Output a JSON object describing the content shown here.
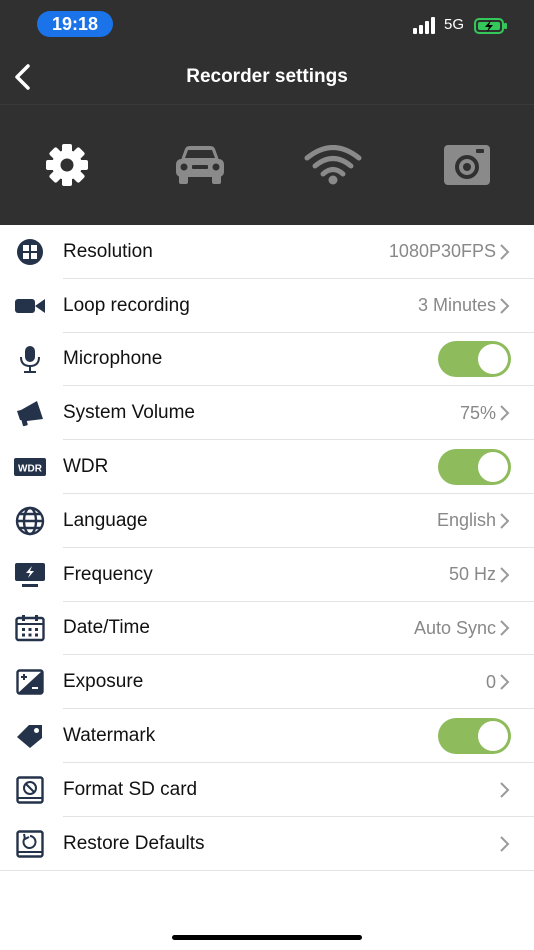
{
  "status_bar": {
    "time": "19:18",
    "network": "5G",
    "icons": [
      "signal-bars-icon",
      "battery-charging-icon"
    ]
  },
  "header": {
    "title": "Recorder settings",
    "back_icon": "chevron-left-icon"
  },
  "tabs": [
    {
      "icon": "gear-icon",
      "active": true
    },
    {
      "icon": "car-icon",
      "active": false
    },
    {
      "icon": "wifi-icon",
      "active": false
    },
    {
      "icon": "camera-icon",
      "active": false
    }
  ],
  "settings": [
    {
      "icon": "resolution-grid-icon",
      "label": "Resolution",
      "value": "1080P30FPS",
      "type": "link"
    },
    {
      "icon": "video-camera-icon",
      "label": "Loop recording",
      "value": "3 Minutes",
      "type": "link"
    },
    {
      "icon": "microphone-icon",
      "label": "Microphone",
      "type": "toggle",
      "on": true
    },
    {
      "icon": "megaphone-icon",
      "label": "System Volume",
      "value": "75%",
      "type": "link"
    },
    {
      "icon": "wdr-icon",
      "label": "WDR",
      "icon_text": "WDR",
      "type": "toggle",
      "on": true
    },
    {
      "icon": "globe-icon",
      "label": "Language",
      "value": "English",
      "type": "link"
    },
    {
      "icon": "monitor-bolt-icon",
      "label": "Frequency",
      "value": "50 Hz",
      "type": "link"
    },
    {
      "icon": "calendar-icon",
      "label": "Date/Time",
      "value": "Auto Sync",
      "type": "link"
    },
    {
      "icon": "exposure-icon",
      "label": "Exposure",
      "value": "0",
      "type": "link"
    },
    {
      "icon": "tag-icon",
      "label": "Watermark",
      "type": "toggle",
      "on": true
    },
    {
      "icon": "sd-card-format-icon",
      "label": "Format SD card",
      "type": "link"
    },
    {
      "icon": "restore-icon",
      "label": "Restore Defaults",
      "type": "link"
    }
  ],
  "colors": {
    "header_bg": "#303030",
    "toggle_on": "#8ebc5c",
    "time_pill": "#1a73e8",
    "battery_fill": "#34c759"
  }
}
